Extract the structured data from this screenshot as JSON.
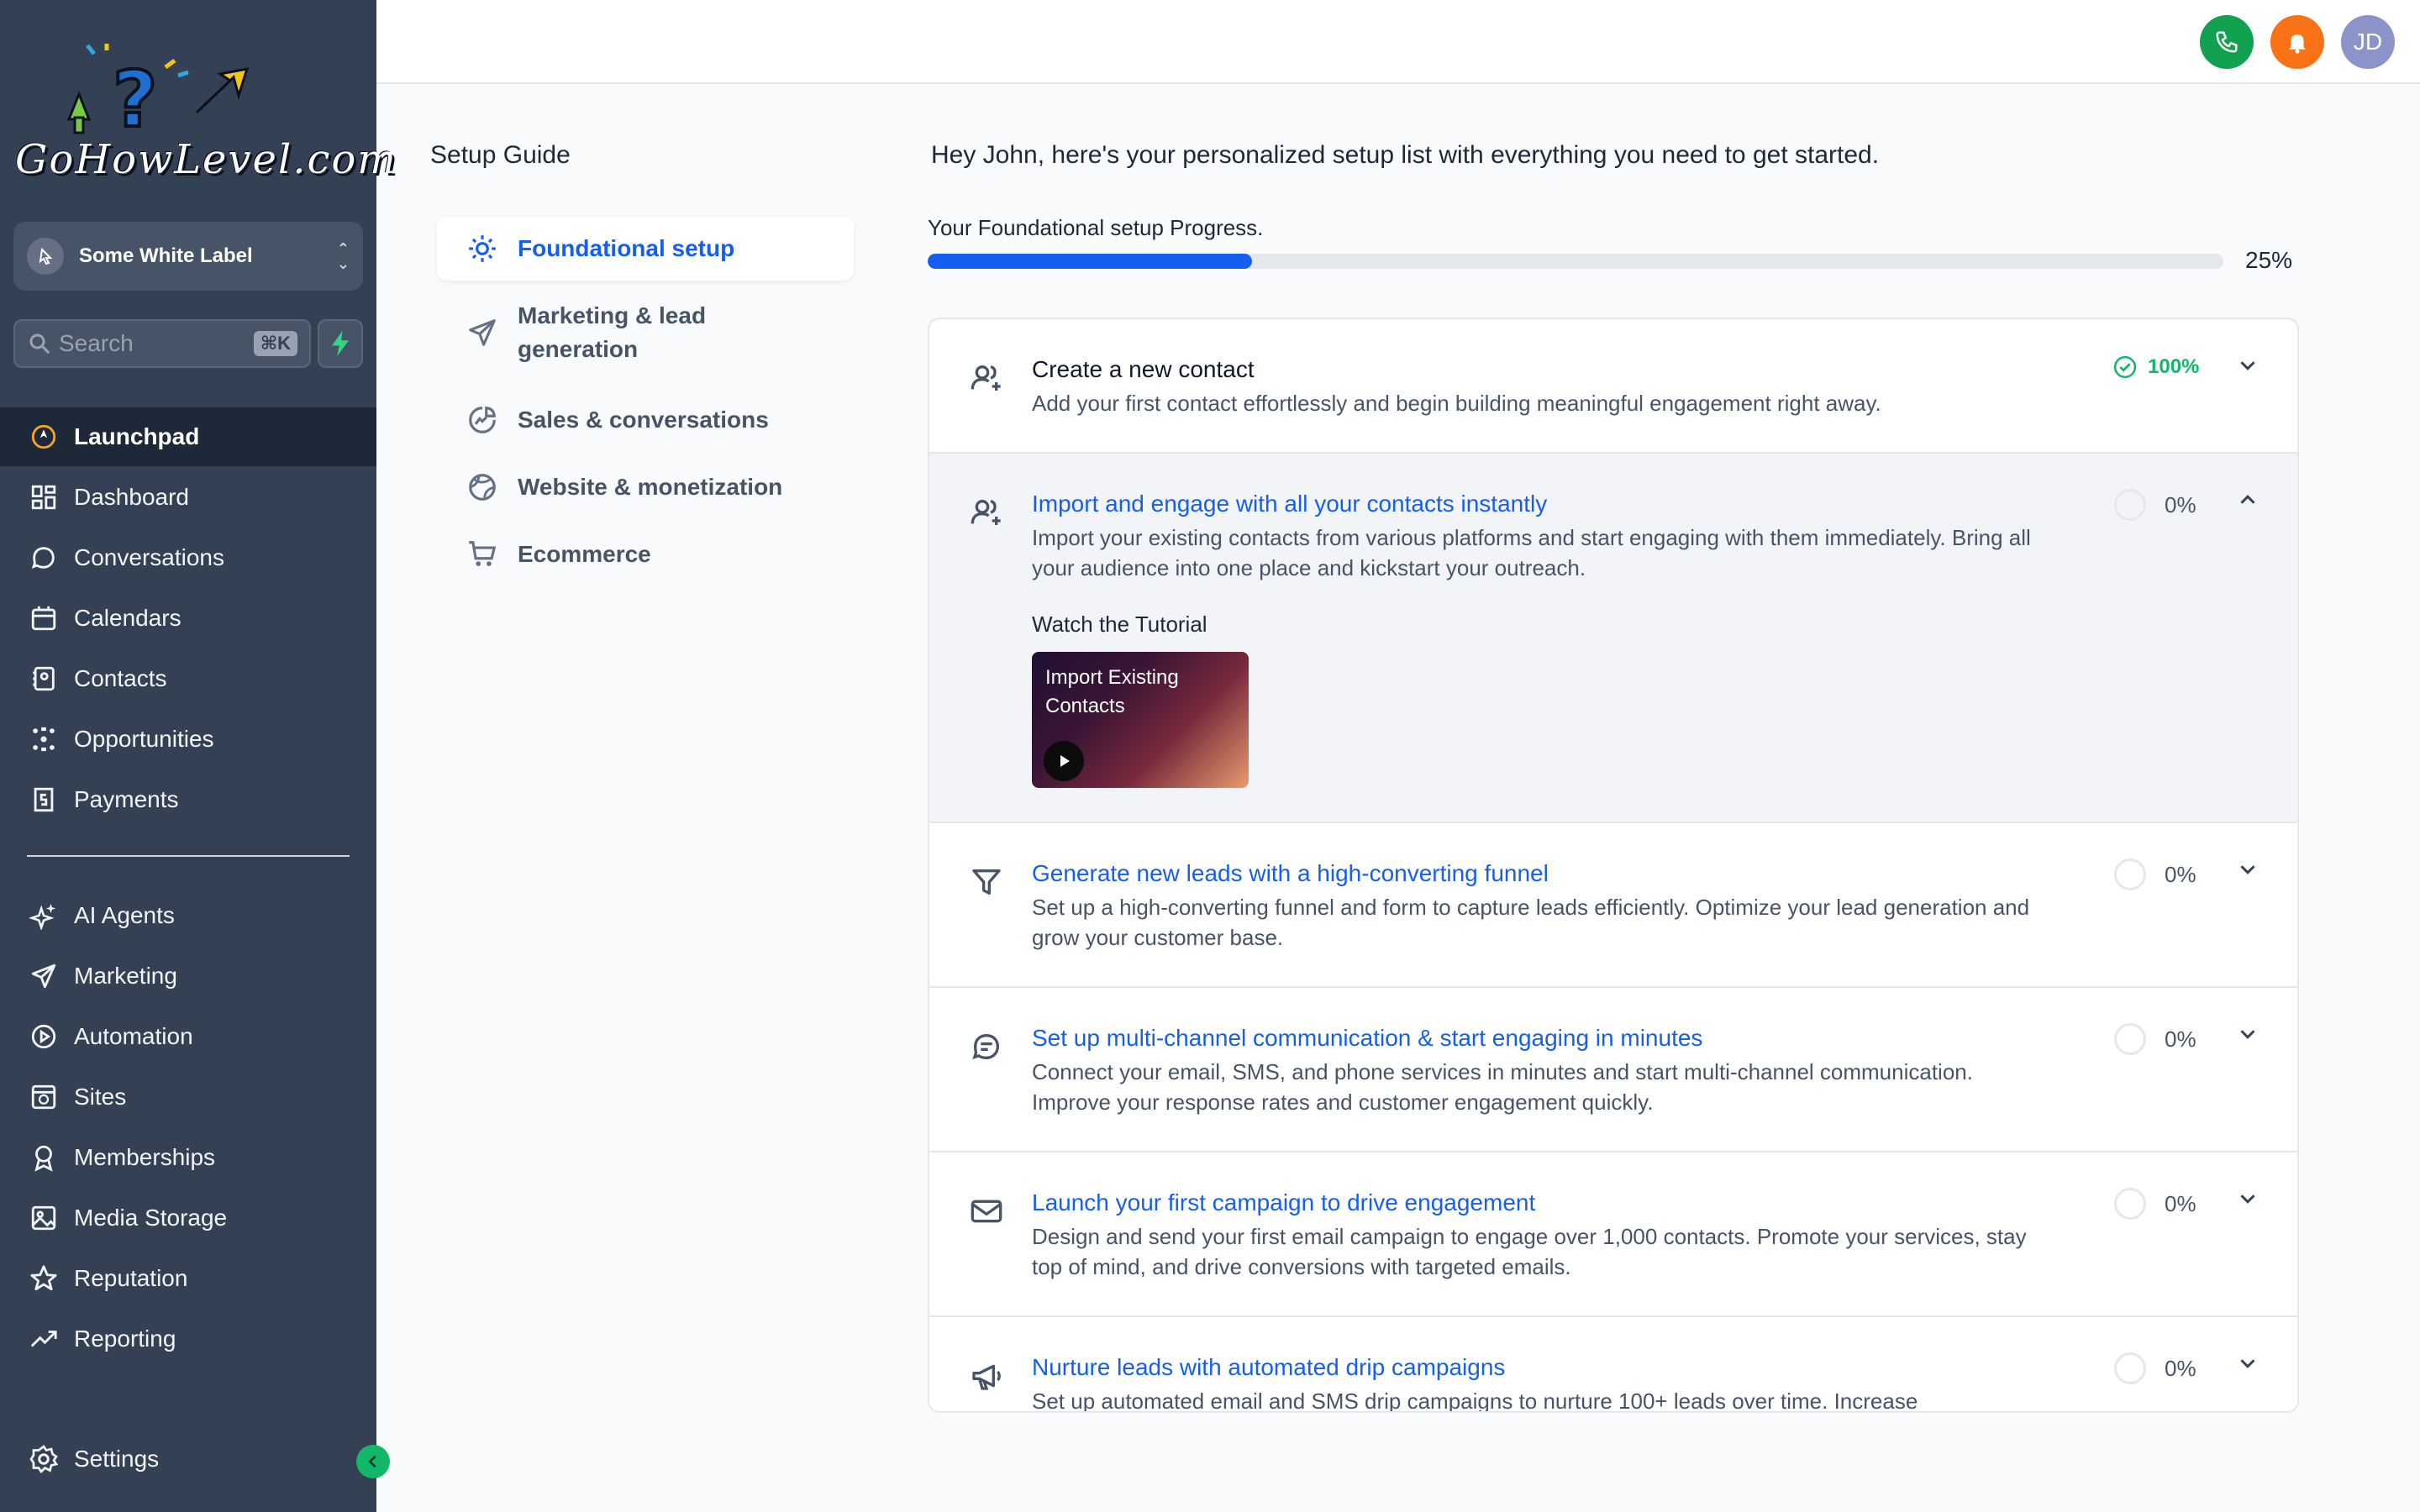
{
  "sidebar": {
    "logo_text": "GoHowLevel.com",
    "account_name": "Some White Label",
    "search_placeholder": "Search",
    "search_shortcut": "⌘K",
    "nav_primary": [
      {
        "label": "Launchpad",
        "icon": "launchpad-icon",
        "active": true
      },
      {
        "label": "Dashboard",
        "icon": "dashboard-icon"
      },
      {
        "label": "Conversations",
        "icon": "chat-icon"
      },
      {
        "label": "Calendars",
        "icon": "calendar-icon"
      },
      {
        "label": "Contacts",
        "icon": "contacts-icon"
      },
      {
        "label": "Opportunities",
        "icon": "opportunities-icon"
      },
      {
        "label": "Payments",
        "icon": "payments-icon"
      }
    ],
    "nav_secondary": [
      {
        "label": "AI Agents",
        "icon": "sparkle-icon"
      },
      {
        "label": "Marketing",
        "icon": "send-icon"
      },
      {
        "label": "Automation",
        "icon": "automation-icon"
      },
      {
        "label": "Sites",
        "icon": "sites-icon"
      },
      {
        "label": "Memberships",
        "icon": "badge-icon"
      },
      {
        "label": "Media Storage",
        "icon": "image-icon"
      },
      {
        "label": "Reputation",
        "icon": "star-icon"
      },
      {
        "label": "Reporting",
        "icon": "trend-icon"
      }
    ],
    "settings_label": "Settings"
  },
  "topbar": {
    "avatar_initials": "JD",
    "colors": {
      "phone": "#12a150",
      "bell": "#f97316",
      "avatar": "#8b93c9"
    }
  },
  "guide": {
    "title": "Setup Guide",
    "items": [
      {
        "label": "Foundational setup",
        "icon": "gear-sparkle-icon",
        "active": true
      },
      {
        "label": "Marketing & lead generation",
        "icon": "send-icon"
      },
      {
        "label": "Sales & conversations",
        "icon": "chart-pie-icon"
      },
      {
        "label": "Website & monetization",
        "icon": "globe-icon"
      },
      {
        "label": "Ecommerce",
        "icon": "cart-icon"
      }
    ]
  },
  "main": {
    "greeting": "Hey John, here's your personalized setup list with everything you need to get started.",
    "progress_label": "Your Foundational setup Progress.",
    "progress_value": 0.25,
    "progress_text": "25%",
    "tasks": [
      {
        "title": "Create a new contact",
        "desc": "Add your first contact effortlessly and begin building meaningful engagement right away.",
        "status": "100%",
        "icon": "user-plus-icon"
      },
      {
        "title": "Import and engage with all your contacts instantly",
        "desc": "Import your existing contacts from various platforms and start engaging with them immediately. Bring all your audience into one place and kickstart your outreach.",
        "status": "0%",
        "icon": "user-plus-icon",
        "tutorial_label": "Watch the Tutorial",
        "video_title": "Import Existing Contacts"
      },
      {
        "title": "Generate new leads with a high-converting funnel",
        "desc": "Set up a high-converting funnel and form to capture leads efficiently. Optimize your lead generation and grow your customer base.",
        "status": "0%",
        "icon": "funnel-icon"
      },
      {
        "title": "Set up multi-channel communication & start engaging in minutes",
        "desc": "Connect your email, SMS, and phone services in minutes and start multi-channel communication. Improve your response rates and customer engagement quickly.",
        "status": "0%",
        "icon": "chat-icon"
      },
      {
        "title": "Launch your first campaign to drive engagement",
        "desc": "Design and send your first email campaign to engage over 1,000 contacts. Promote your services, stay top of mind, and drive conversions with targeted emails.",
        "status": "0%",
        "icon": "mail-icon"
      },
      {
        "title": "Nurture leads with automated drip campaigns",
        "desc": "Set up automated email and SMS drip campaigns to nurture 100+ leads over time. Increase",
        "status": "0%",
        "icon": "megaphone-icon"
      }
    ]
  }
}
